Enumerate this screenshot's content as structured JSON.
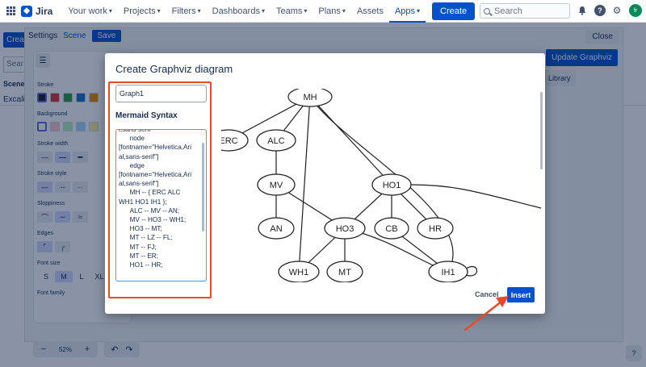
{
  "topbar": {
    "logo_text": "Jira",
    "nav": [
      {
        "label": "Your work",
        "chevron": true
      },
      {
        "label": "Projects",
        "chevron": true
      },
      {
        "label": "Filters",
        "chevron": true
      },
      {
        "label": "Dashboards",
        "chevron": true
      },
      {
        "label": "Teams",
        "chevron": true
      },
      {
        "label": "Plans",
        "chevron": true
      },
      {
        "label": "Assets",
        "chevron": false
      },
      {
        "label": "Apps",
        "chevron": true
      }
    ],
    "create_label": "Create",
    "search_placeholder": "Search",
    "avatar_initials": "fr"
  },
  "background": {
    "create_label": "Crea",
    "search_text": "Sear",
    "scene_label": "Scene N",
    "excalid_text": "Excalid"
  },
  "editor": {
    "tab_settings": "Settings",
    "tab_scene": "Scene",
    "save_label": "Save",
    "close_label": "Close",
    "update_label": "Update Graphviz",
    "library_label": "Library",
    "stroke_label": "Stroke",
    "background_label": "Background",
    "stroke_width_label": "Stroke width",
    "stroke_style_label": "Stroke style",
    "sloppiness_label": "Sloppiness",
    "edges_label": "Edges",
    "font_size_label": "Font size",
    "font_family_label": "Font family",
    "font_sizes": [
      "S",
      "M",
      "L",
      "XL"
    ],
    "zoom_level": "52%",
    "stroke_colors": [
      "#1e1e1e",
      "#e03131",
      "#2f9e44",
      "#1971c2",
      "#f08c00"
    ],
    "background_colors": [
      "#ffffff",
      "#ffc9c9",
      "#b2f2bb",
      "#a5d8ff",
      "#ffec99"
    ]
  },
  "dialog": {
    "title": "Create Graphviz diagram",
    "name_value": "Graph1",
    "syntax_label": "Mermaid Syntax",
    "code_lines": [
      "l,sans-serif\"",
      "      node",
      "[fontname=\"Helvetica,Ari",
      "al,sans-serif\"]",
      "      edge",
      "[fontname=\"Helvetica,Ari",
      "al,sans-serif\"]",
      "      MH -- { ERC ALC",
      "WH1 HO1 IH1 };",
      "      ALC -- MV -- AN;",
      "      MV -- HO3 -- WH1;",
      "      HO3 -- MT;",
      "      MT -- LZ -- FL;",
      "      MT -- FJ;",
      "      MT -- ER;",
      "      HO1 -- HR;"
    ],
    "cancel_label": "Cancel",
    "insert_label": "Insert",
    "graph_nodes": [
      {
        "id": "MH",
        "label": "MH"
      },
      {
        "id": "ERC",
        "label": "ERC"
      },
      {
        "id": "ALC",
        "label": "ALC"
      },
      {
        "id": "MV",
        "label": "MV"
      },
      {
        "id": "HO1",
        "label": "HO1"
      },
      {
        "id": "AN",
        "label": "AN"
      },
      {
        "id": "HO3",
        "label": "HO3"
      },
      {
        "id": "CB",
        "label": "CB"
      },
      {
        "id": "HR",
        "label": "HR"
      },
      {
        "id": "WH1",
        "label": "WH1"
      },
      {
        "id": "MT",
        "label": "MT"
      },
      {
        "id": "IH1",
        "label": "IH1"
      }
    ],
    "graph_edges": [
      [
        "MH",
        "ERC"
      ],
      [
        "MH",
        "ALC"
      ],
      [
        "MH",
        "WH1"
      ],
      [
        "MH",
        "HO1"
      ],
      [
        "MH",
        "IH1"
      ],
      [
        "ALC",
        "MV"
      ],
      [
        "MV",
        "AN"
      ],
      [
        "MV",
        "HO3"
      ],
      [
        "HO3",
        "WH1"
      ],
      [
        "HO3",
        "MT"
      ],
      [
        "HO1",
        "HO3"
      ],
      [
        "HO1",
        "CB"
      ],
      [
        "HO1",
        "HR"
      ],
      [
        "HO3",
        "IH1"
      ],
      [
        "CB",
        "IH1"
      ]
    ]
  }
}
